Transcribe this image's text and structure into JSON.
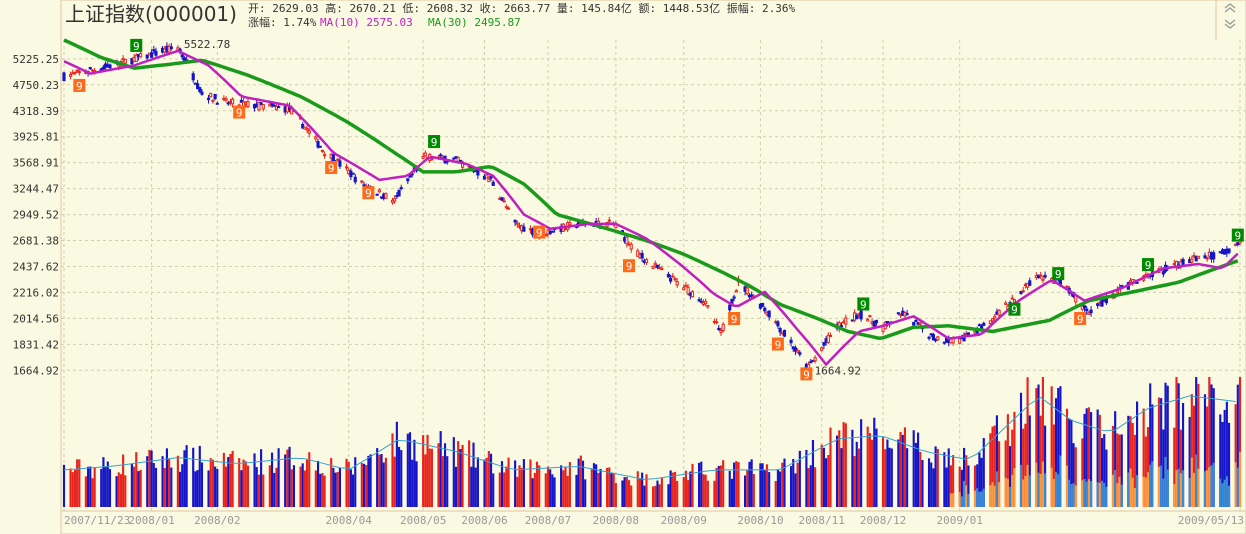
{
  "title": "上证指数(000001)",
  "info": {
    "line1": "开: 2629.03 高: 2670.21 低: 2608.32 收: 2663.77 量: 145.84亿 额: 1448.53亿 振幅: 2.36%",
    "change": "涨幅: 1.74%",
    "ma10": "MA(10) 2575.03",
    "ma30": "MA(30) 2495.87"
  },
  "colors": {
    "up": "#e8231b",
    "down": "#1414c8",
    "ma10": "#c020c0",
    "ma30": "#1a9a1a",
    "grid": "#cfcfb0",
    "signal_green": "#008a00",
    "signal_orange": "#ff6a1a"
  },
  "icons": {
    "scroll_up": "double-chevron-up-icon",
    "scroll_down": "double-chevron-down-icon"
  },
  "chart_data": {
    "type": "candlestick",
    "title": "上证指数(000001)",
    "yaxis": {
      "scale": "log",
      "ylim": [
        1560,
        5600
      ],
      "ticks": [
        "5225.25",
        "4750.23",
        "4318.39",
        "3925.81",
        "3568.91",
        "3244.47",
        "2949.52",
        "2681.38",
        "2437.62",
        "2216.02",
        "2014.56",
        "1831.42",
        "1664.92"
      ]
    },
    "xaxis": {
      "range": [
        "2007-11-23",
        "2009-05-13"
      ],
      "ticks": [
        {
          "label": "2007/11/23",
          "date": "2007-11-23"
        },
        {
          "label": "2008/01",
          "date": "2008-01-02"
        },
        {
          "label": "2008/02",
          "date": "2008-02-01"
        },
        {
          "label": "2008/04",
          "date": "2008-04-01"
        },
        {
          "label": "2008/05",
          "date": "2008-05-05"
        },
        {
          "label": "2008/06",
          "date": "2008-06-02"
        },
        {
          "label": "2008/07",
          "date": "2008-07-01"
        },
        {
          "label": "2008/08",
          "date": "2008-08-01"
        },
        {
          "label": "2008/09",
          "date": "2008-09-01"
        },
        {
          "label": "2008/10",
          "date": "2008-10-06"
        },
        {
          "label": "2008/11",
          "date": "2008-11-03"
        },
        {
          "label": "2008/12",
          "date": "2008-12-01"
        },
        {
          "label": "2009/01",
          "date": "2009-01-05"
        },
        {
          "label": "2009/05/13",
          "date": "2009-05-13"
        }
      ]
    },
    "close_path": [
      [
        "2007-11-23",
        4900
      ],
      [
        "2007-12-10",
        5050
      ],
      [
        "2008-01-14",
        5450
      ],
      [
        "2008-01-25",
        4600
      ],
      [
        "2008-02-05",
        4450
      ],
      [
        "2008-03-05",
        4350
      ],
      [
        "2008-03-20",
        3750
      ],
      [
        "2008-04-07",
        3300
      ],
      [
        "2008-04-22",
        3100
      ],
      [
        "2008-05-06",
        3650
      ],
      [
        "2008-05-20",
        3600
      ],
      [
        "2008-06-05",
        3350
      ],
      [
        "2008-06-16",
        2850
      ],
      [
        "2008-06-27",
        2750
      ],
      [
        "2008-07-15",
        2850
      ],
      [
        "2008-07-31",
        2850
      ],
      [
        "2008-08-11",
        2550
      ],
      [
        "2008-08-25",
        2350
      ],
      [
        "2008-09-10",
        2150
      ],
      [
        "2008-09-18",
        1900
      ],
      [
        "2008-09-26",
        2300
      ],
      [
        "2008-10-10",
        2050
      ],
      [
        "2008-10-24",
        1750
      ],
      [
        "2008-10-28",
        1680
      ],
      [
        "2008-11-10",
        1950
      ],
      [
        "2008-11-20",
        2050
      ],
      [
        "2008-12-01",
        1950
      ],
      [
        "2008-12-10",
        2050
      ],
      [
        "2008-12-24",
        1880
      ],
      [
        "2009-01-05",
        1850
      ],
      [
        "2009-01-20",
        2000
      ],
      [
        "2009-02-10",
        2350
      ],
      [
        "2009-02-20",
        2300
      ],
      [
        "2009-03-05",
        2050
      ],
      [
        "2009-03-20",
        2250
      ],
      [
        "2009-04-01",
        2350
      ],
      [
        "2009-04-20",
        2500
      ],
      [
        "2009-05-04",
        2550
      ],
      [
        "2009-05-13",
        2663.77
      ]
    ],
    "ma10": [
      [
        "2007-11-23",
        5180
      ],
      [
        "2007-12-05",
        4950
      ],
      [
        "2007-12-25",
        5100
      ],
      [
        "2008-01-14",
        5380
      ],
      [
        "2008-01-28",
        5100
      ],
      [
        "2008-02-12",
        4550
      ],
      [
        "2008-03-05",
        4400
      ],
      [
        "2008-03-25",
        3700
      ],
      [
        "2008-04-15",
        3350
      ],
      [
        "2008-04-28",
        3400
      ],
      [
        "2008-05-08",
        3650
      ],
      [
        "2008-05-25",
        3550
      ],
      [
        "2008-06-06",
        3400
      ],
      [
        "2008-06-20",
        2950
      ],
      [
        "2008-07-02",
        2800
      ],
      [
        "2008-07-20",
        2850
      ],
      [
        "2008-08-01",
        2850
      ],
      [
        "2008-08-15",
        2700
      ],
      [
        "2008-09-01",
        2430
      ],
      [
        "2008-09-15",
        2200
      ],
      [
        "2008-09-25",
        2100
      ],
      [
        "2008-10-08",
        2220
      ],
      [
        "2008-10-22",
        1950
      ],
      [
        "2008-11-05",
        1700
      ],
      [
        "2008-11-20",
        1920
      ],
      [
        "2008-12-01",
        1960
      ],
      [
        "2008-12-15",
        2030
      ],
      [
        "2008-12-31",
        1870
      ],
      [
        "2009-01-15",
        1900
      ],
      [
        "2009-02-01",
        2150
      ],
      [
        "2009-02-16",
        2320
      ],
      [
        "2009-03-03",
        2150
      ],
      [
        "2009-03-20",
        2250
      ],
      [
        "2009-04-08",
        2420
      ],
      [
        "2009-04-24",
        2460
      ],
      [
        "2009-05-05",
        2420
      ],
      [
        "2009-05-13",
        2575.03
      ]
    ],
    "ma30": [
      [
        "2007-11-23",
        5600
      ],
      [
        "2007-12-10",
        5250
      ],
      [
        "2007-12-25",
        5050
      ],
      [
        "2008-01-10",
        5120
      ],
      [
        "2008-01-25",
        5200
      ],
      [
        "2008-02-15",
        4920
      ],
      [
        "2008-03-10",
        4550
      ],
      [
        "2008-03-31",
        4150
      ],
      [
        "2008-04-22",
        3700
      ],
      [
        "2008-05-05",
        3450
      ],
      [
        "2008-05-20",
        3450
      ],
      [
        "2008-06-05",
        3520
      ],
      [
        "2008-06-20",
        3300
      ],
      [
        "2008-07-05",
        2950
      ],
      [
        "2008-07-25",
        2820
      ],
      [
        "2008-08-15",
        2680
      ],
      [
        "2008-09-01",
        2550
      ],
      [
        "2008-09-15",
        2420
      ],
      [
        "2008-09-30",
        2280
      ],
      [
        "2008-10-15",
        2120
      ],
      [
        "2008-10-31",
        2020
      ],
      [
        "2008-11-15",
        1920
      ],
      [
        "2008-11-30",
        1870
      ],
      [
        "2008-12-15",
        1950
      ],
      [
        "2008-12-31",
        1960
      ],
      [
        "2009-01-20",
        1920
      ],
      [
        "2009-02-15",
        2000
      ],
      [
        "2009-03-05",
        2150
      ],
      [
        "2009-03-25",
        2220
      ],
      [
        "2009-04-15",
        2300
      ],
      [
        "2009-05-13",
        2495.87
      ]
    ],
    "annotations": [
      {
        "text": "5522.78",
        "date": "2008-01-14",
        "value": 5522.78
      },
      {
        "text": "1664.92",
        "date": "2008-10-28",
        "value": 1664.92
      }
    ],
    "signals": [
      {
        "text": "9",
        "kind": "green",
        "date": "2007-12-26",
        "value": 5480
      },
      {
        "text": "9",
        "kind": "orange",
        "date": "2007-11-30",
        "value": 4730
      },
      {
        "text": "9",
        "kind": "orange",
        "date": "2008-02-11",
        "value": 4290
      },
      {
        "text": "9",
        "kind": "orange",
        "date": "2008-03-24",
        "value": 3500
      },
      {
        "text": "9",
        "kind": "orange",
        "date": "2008-04-10",
        "value": 3190
      },
      {
        "text": "9",
        "kind": "green",
        "date": "2008-05-10",
        "value": 3850
      },
      {
        "text": "9",
        "kind": "orange",
        "date": "2008-06-27",
        "value": 2760
      },
      {
        "text": "9",
        "kind": "orange",
        "date": "2008-08-07",
        "value": 2440
      },
      {
        "text": "9",
        "kind": "orange",
        "date": "2008-09-24",
        "value": 2010
      },
      {
        "text": "9",
        "kind": "orange",
        "date": "2008-10-14",
        "value": 1830
      },
      {
        "text": "9",
        "kind": "orange",
        "date": "2008-10-27",
        "value": 1640
      },
      {
        "text": "9",
        "kind": "green",
        "date": "2008-11-22",
        "value": 2120
      },
      {
        "text": "9",
        "kind": "green",
        "date": "2009-01-30",
        "value": 2080
      },
      {
        "text": "9",
        "kind": "green",
        "date": "2009-02-19",
        "value": 2370
      },
      {
        "text": "9",
        "kind": "orange",
        "date": "2009-03-01",
        "value": 2010
      },
      {
        "text": "9",
        "kind": "green",
        "date": "2009-04-01",
        "value": 2450
      },
      {
        "text": "9",
        "kind": "green",
        "date": "2009-05-12",
        "value": 2730
      }
    ],
    "volume": {
      "overlay_bands": [
        "2009-01-01",
        "2009-05-13"
      ],
      "levels": [
        [
          "2007-11-23",
          0.3
        ],
        [
          "2007-12-15",
          0.33
        ],
        [
          "2008-01-14",
          0.4
        ],
        [
          "2008-02-10",
          0.35
        ],
        [
          "2008-03-10",
          0.4
        ],
        [
          "2008-04-01",
          0.3
        ],
        [
          "2008-04-24",
          0.55
        ],
        [
          "2008-05-20",
          0.45
        ],
        [
          "2008-06-15",
          0.3
        ],
        [
          "2008-07-15",
          0.33
        ],
        [
          "2008-08-15",
          0.22
        ],
        [
          "2008-09-15",
          0.3
        ],
        [
          "2008-10-15",
          0.3
        ],
        [
          "2008-11-10",
          0.55
        ],
        [
          "2008-11-30",
          0.58
        ],
        [
          "2008-12-20",
          0.45
        ],
        [
          "2009-01-10",
          0.38
        ],
        [
          "2009-02-10",
          0.9
        ],
        [
          "2009-02-25",
          0.7
        ],
        [
          "2009-03-15",
          0.6
        ],
        [
          "2009-04-01",
          0.8
        ],
        [
          "2009-04-20",
          0.9
        ],
        [
          "2009-05-13",
          0.85
        ]
      ]
    }
  }
}
